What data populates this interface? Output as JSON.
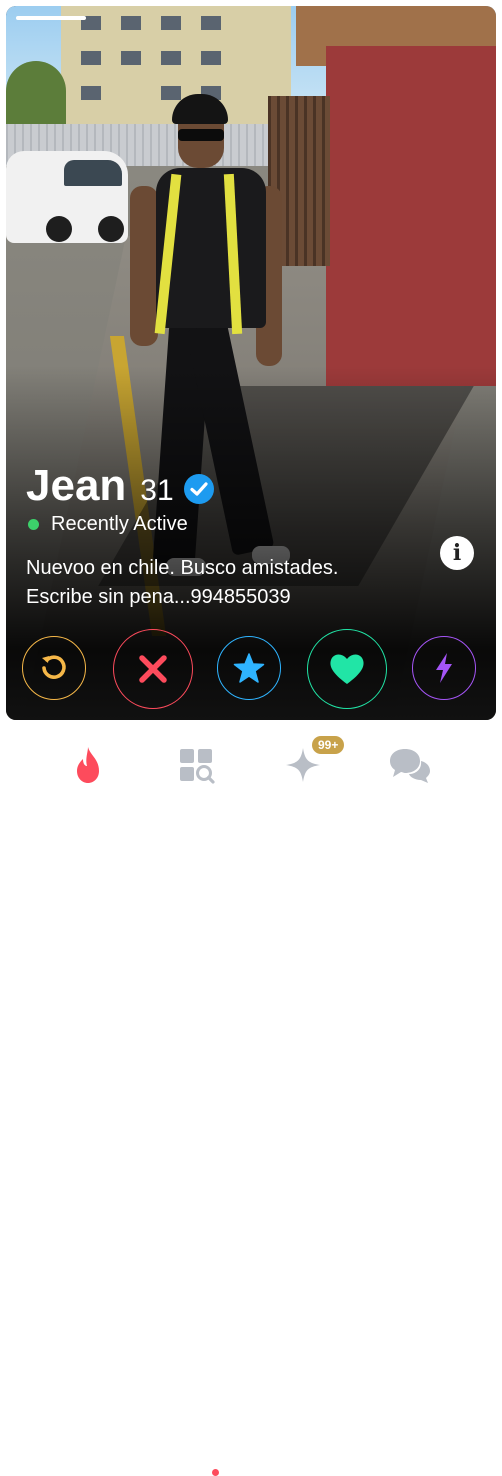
{
  "profile": {
    "name": "Jean",
    "age": "31",
    "status": "Recently Active",
    "bio_line1": "Nuevoo en chile. Busco amistades.",
    "bio_line2": "Escribe sin pena...994855039"
  },
  "icons": {
    "verified": "verified-check-icon",
    "info": "info-icon",
    "rewind": "rewind-icon",
    "nope": "close-x-icon",
    "superlike": "star-icon",
    "like": "heart-icon",
    "boost": "lightning-icon",
    "nav": [
      "flame-icon",
      "explore-icon",
      "sparkle-icon",
      "chat-icon"
    ]
  },
  "nav": {
    "badge": "99+"
  },
  "colors": {
    "rewind": "#f5b748",
    "nope": "#fd4b5c",
    "superlike": "#2fb4ff",
    "like": "#21e5a6",
    "boost": "#a555f6",
    "brand": "#fd4b5c",
    "verified": "#1d9bf0",
    "online": "#3cd16a"
  }
}
